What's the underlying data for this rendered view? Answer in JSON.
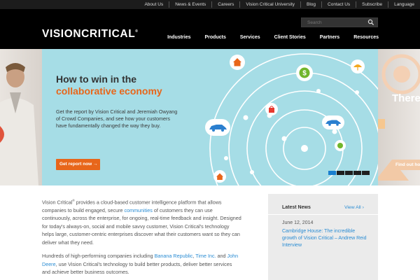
{
  "utility_nav": [
    "About Us",
    "News & Events",
    "Careers",
    "Vision Critical University",
    "Blog",
    "Contact Us",
    "Subscribe",
    "Language"
  ],
  "brand": {
    "logo_text": "VISIONCRITICAL",
    "registered": "®"
  },
  "search": {
    "placeholder": "Search",
    "icon": "search-icon"
  },
  "main_nav": [
    "Industries",
    "Products",
    "Services",
    "Client Stories",
    "Partners",
    "Resources"
  ],
  "hero": {
    "title": "How to win in the",
    "title_accent": "collaborative economy",
    "description": "Get the report by Vision Critical and Jeremiah Owyang of Crowd Companies, and see how your customers have fundamentally changed the way they buy.",
    "button": "Get report now →",
    "icons": [
      "house-icon",
      "dollar-icon",
      "umbrella-icon",
      "shopping-bag-icon",
      "car-icon",
      "bicycle-icon",
      "house-icon"
    ],
    "next_slide_title": "There",
    "next_slide_button": "Find out how"
  },
  "slider": {
    "slide_count": 5,
    "active_index": 0
  },
  "intro": {
    "p1_a": "Vision Critical",
    "p1_reg": "®",
    "p1_b": " provides a cloud-based customer intelligence platform that allows companies to build engaged, secure ",
    "p1_link": "communities",
    "p1_c": " of customers they can use continuously, across the enterprise, for ongoing, real-time feedback and insight. Designed for today's always-on, social and mobile savvy customer, Vision Critical's technology helps large, customer-centric enterprises discover what their customers want so they can deliver what they need.",
    "p2_a": "Hundreds of high-performing companies including ",
    "p2_link1": "Banana Republic",
    "p2_sep": ", ",
    "p2_link2": "Time Inc.",
    "p2_and": " and ",
    "p2_link3": "John Deere",
    "p2_b": ", use Vision Critical's technology to build better products, deliver better services and achieve better business outcomes."
  },
  "news": {
    "title": "Latest News",
    "view_all": "View All ›",
    "date": "June 12, 2014",
    "headline": "Cambridge House: The incredible growth of Vision Critical – Andrew Reid Interview"
  },
  "colors": {
    "accent": "#e8661a",
    "link": "#2a8cd3",
    "slide_bg": "#a6dde6"
  }
}
